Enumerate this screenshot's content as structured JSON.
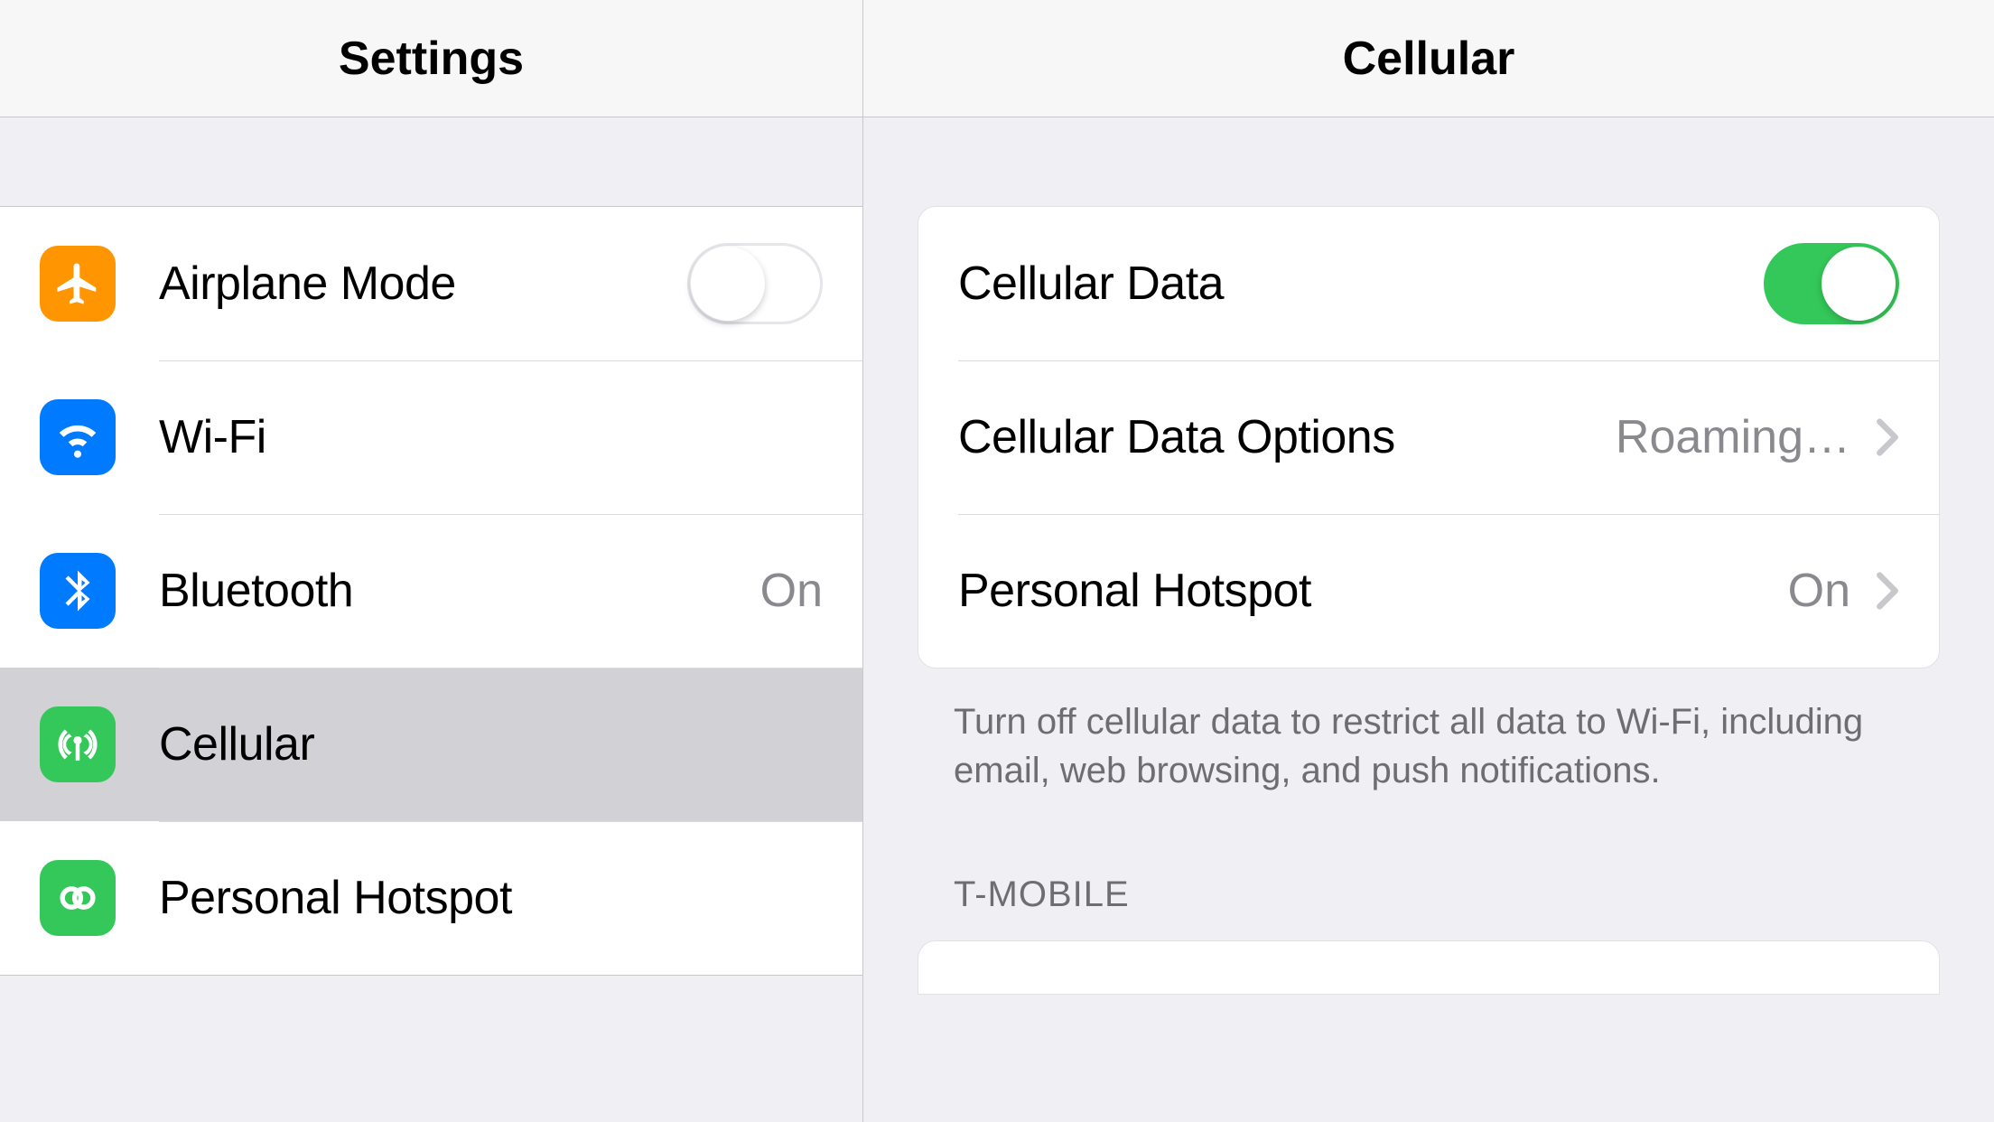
{
  "sidebar": {
    "title": "Settings",
    "items": [
      {
        "label": "Airplane Mode",
        "toggle": false
      },
      {
        "label": "Wi-Fi"
      },
      {
        "label": "Bluetooth",
        "value": "On"
      },
      {
        "label": "Cellular",
        "selected": true
      },
      {
        "label": "Personal Hotspot"
      }
    ]
  },
  "detail": {
    "title": "Cellular",
    "rows": [
      {
        "label": "Cellular Data",
        "toggle": true
      },
      {
        "label": "Cellular Data Options",
        "value": "Roaming…"
      },
      {
        "label": "Personal Hotspot",
        "value": "On"
      }
    ],
    "footer": "Turn off cellular data to restrict all data to Wi-Fi, including email, web browsing, and push notifications.",
    "section_header": "T-MOBILE"
  },
  "colors": {
    "orange": "#ff9500",
    "blue": "#007aff",
    "green": "#34c759"
  }
}
